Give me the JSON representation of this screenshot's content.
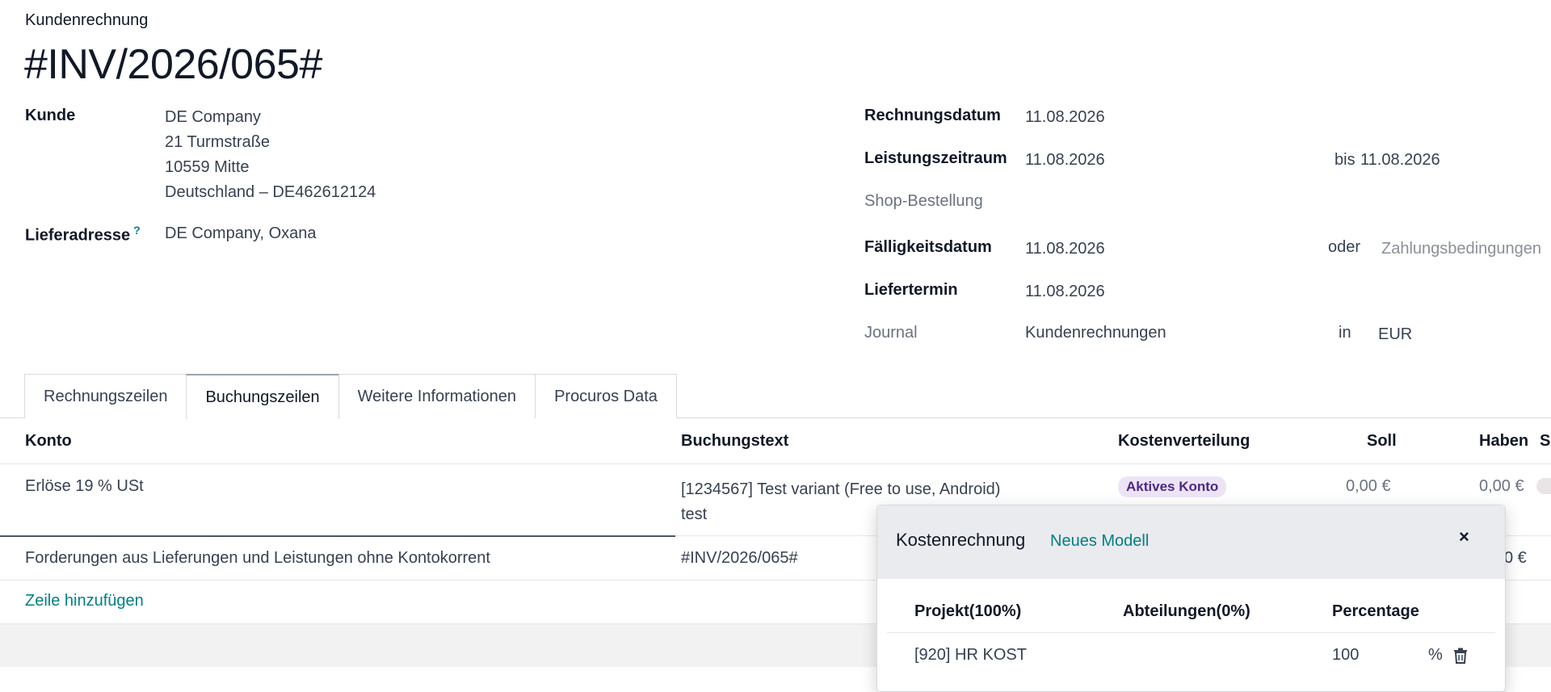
{
  "header": {
    "doc_type": "Kundenrechnung",
    "invoice_number": "#INV/2026/065#"
  },
  "left_fields": {
    "customer_label": "Kunde",
    "customer_lines": [
      "DE Company",
      "21 Turmstraße",
      "10559 Mitte",
      "Deutschland – DE462612124"
    ],
    "delivery_label": "Lieferadresse",
    "delivery_help": "?",
    "delivery_value": "DE Company, Oxana"
  },
  "right_fields": {
    "invoice_date_label": "Rechnungsdatum",
    "invoice_date": "11.08.2026",
    "service_period_label": "Leistungszeitraum",
    "service_period_from": "11.08.2026",
    "service_period_to_label": "bis",
    "service_period_to": "11.08.2026",
    "shop_order_label": "Shop-Bestellung",
    "due_date_label": "Fälligkeitsdatum",
    "due_date": "11.08.2026",
    "or_label": "oder",
    "payment_terms_placeholder": "Zahlungsbedingungen",
    "delivery_date_label": "Liefertermin",
    "delivery_date": "11.08.2026",
    "journal_label": "Journal",
    "journal_value": "Kundenrechnungen",
    "in_label": "in",
    "currency": "EUR"
  },
  "tabs": [
    {
      "label": "Rechnungszeilen",
      "active": false
    },
    {
      "label": "Buchungszeilen",
      "active": true
    },
    {
      "label": "Weitere Informationen",
      "active": false
    },
    {
      "label": "Procuros Data",
      "active": false
    }
  ],
  "table": {
    "columns": [
      "Konto",
      "Buchungstext",
      "Kostenverteilung",
      "Soll",
      "Haben",
      "S"
    ],
    "rows": [
      {
        "account": "Erlöse 19 % USt",
        "text_line1": "[1234567] Test variant (Free to use, Android)",
        "text_line2": "test",
        "distribution": "Aktives Konto",
        "debit": "0,00 €",
        "credit": "0,00 €"
      },
      {
        "account": "Forderungen aus Lieferungen und Leistungen ohne Kontokorrent",
        "text_line1": "#INV/2026/065#",
        "credit_partial": "0 €"
      }
    ],
    "add_line_label": "Zeile hinzufügen"
  },
  "popup": {
    "title": "Kostenrechnung",
    "new_model_label": "Neues Modell",
    "close_icon": "×",
    "columns": [
      "Projekt(100%)",
      "Abteilungen(0%)",
      "Percentage"
    ],
    "row": {
      "project": "[920] HR KOST",
      "department": "",
      "percentage": "100",
      "unit": "%"
    }
  },
  "colors": {
    "accent": "#017e84",
    "badge_bg": "#ede4f7",
    "badge_text": "#4c2a85"
  }
}
